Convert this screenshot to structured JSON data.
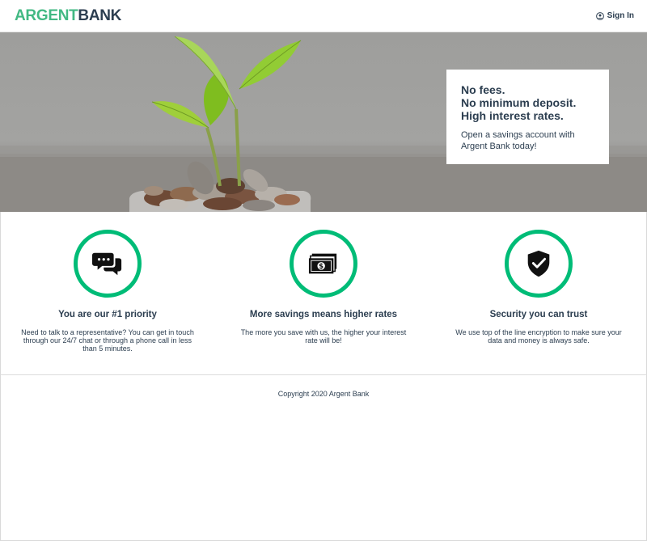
{
  "header": {
    "logo_part1": "ARGENT",
    "logo_part2": "BANK",
    "signin_label": "Sign In",
    "accent_color": "#42b983"
  },
  "hero": {
    "headline_lines": [
      "No fees.",
      "No minimum deposit.",
      "High interest rates."
    ],
    "subtitle": "Open a savings account with Argent Bank today!"
  },
  "features": [
    {
      "icon": "chat-icon",
      "title": "You are our #1 priority",
      "text": "Need to talk to a representative? You can get in touch through our 24/7 chat or through a phone call in less than 5 minutes."
    },
    {
      "icon": "money-icon",
      "title": "More savings means higher rates",
      "text": "The more you save with us, the higher your interest rate will be!"
    },
    {
      "icon": "security-shield-icon",
      "title": "Security you can trust",
      "text": "We use top of the line encryption to make sure your data and money is always safe."
    }
  ],
  "footer": {
    "copyright": "Copyright 2020 Argent Bank"
  },
  "ring_color": "#00bc77"
}
